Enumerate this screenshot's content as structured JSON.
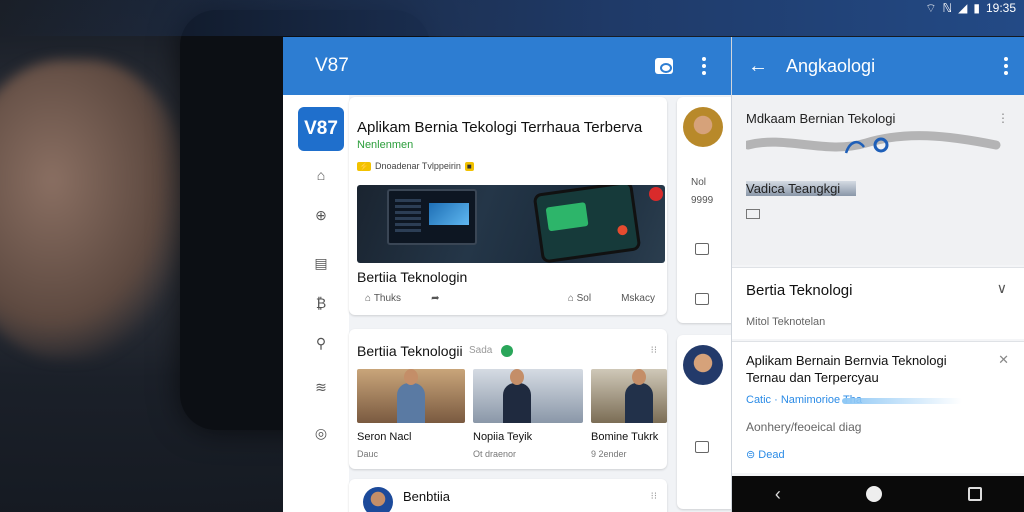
{
  "status_bar": {
    "time": "19:35",
    "icons": [
      "wifi-icon",
      "nfc-icon",
      "signal-icon",
      "battery-icon"
    ]
  },
  "left_panel": {
    "app_title": "V87",
    "rail": {
      "logo": "V87",
      "items": [
        {
          "icon": "home-icon"
        },
        {
          "icon": "globe-icon"
        },
        {
          "icon": "calendar-icon"
        },
        {
          "icon": "bitcoin-icon"
        },
        {
          "icon": "search-icon"
        },
        {
          "icon": "wifi-icon"
        },
        {
          "icon": "location-icon"
        }
      ]
    },
    "featured": {
      "title": "Aplikam Bernia Tekologi Terrhaua Terberva",
      "meta1": "Nenlenmen",
      "meta2": "Dnoadenar Tvlppeirin",
      "caption": "Bertiia Teknologin",
      "foot_left": "Thuks",
      "foot_mid": "Sol",
      "foot_right": "Mskacy"
    },
    "gallery": {
      "title": "Bertiia Teknologii",
      "sub": "Sada",
      "items": [
        {
          "label": "Seron Nacl",
          "sub": "Dauc"
        },
        {
          "label": "Nopiia Teyik",
          "sub": "Ot draenor"
        },
        {
          "label": "Bomine Tukrk",
          "sub": "9 2ender"
        }
      ]
    },
    "third": {
      "title": "Benbtiia"
    },
    "mini": {
      "t1": "Nol",
      "t2": "9999"
    }
  },
  "right_panel": {
    "title": "Angkaologi",
    "sec1_title": "Mdkaam Bernian Tekologi",
    "sec1_sub": "Vadica Teangkgi",
    "sec2_title": "Bertia Teknologi",
    "sec2_sub": "Mitol Teknotelan",
    "sec3_title": "Aplikam Bernain Bernvia Teknologi Ternau dan Terpercyau",
    "sec3_link": "Catic · Namimorioe Tha",
    "sec3_sub": "Aonhery/feoeical diag",
    "sec3_action": "Dead"
  },
  "colors": {
    "app_bar": "#2d7dd2",
    "accent_green": "#2a9d3a",
    "link_blue": "#2b8be6"
  }
}
